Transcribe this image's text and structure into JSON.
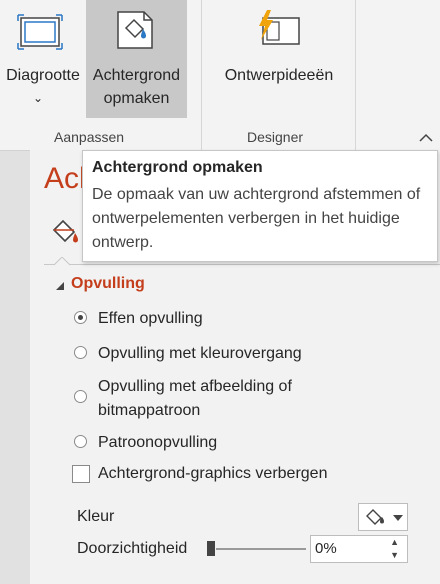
{
  "ribbon": {
    "buttons": [
      {
        "label": "Diagrootte",
        "icon": "slide-size-icon",
        "has_dropdown": true
      },
      {
        "label_line1": "Achtergrond",
        "label_line2": "opmaken",
        "icon": "format-background-icon",
        "state": "hover"
      },
      {
        "label": "Ontwerpideeën",
        "icon": "design-ideas-icon"
      }
    ],
    "groups": [
      {
        "label": "Aanpassen"
      },
      {
        "label": "Designer"
      }
    ]
  },
  "tooltip": {
    "title": "Achtergrond opmaken",
    "body": "De opmaak van uw achtergrond afstemmen of ontwerpelementen verbergen in het huidige ontwerp."
  },
  "pane": {
    "title": "Ach",
    "section": "Opvulling",
    "fill_options": [
      {
        "label": "Effen opvulling",
        "selected": true
      },
      {
        "label": "Opvulling met kleurovergang",
        "selected": false
      },
      {
        "label_line1": "Opvulling met afbeelding of",
        "label_line2": "bitmappatroon",
        "selected": false
      },
      {
        "label": "Patroonopvulling",
        "selected": false
      }
    ],
    "hide_graphics": {
      "label": "Achtergrond-graphics verbergen",
      "checked": false
    },
    "color_label": "Kleur",
    "transparency_label": "Doorzichtigheid",
    "transparency_value": "0%"
  },
  "colors": {
    "accent": "#c43e1c",
    "lightning": "#f0a30a",
    "icon_blue": "#2b78c5"
  }
}
